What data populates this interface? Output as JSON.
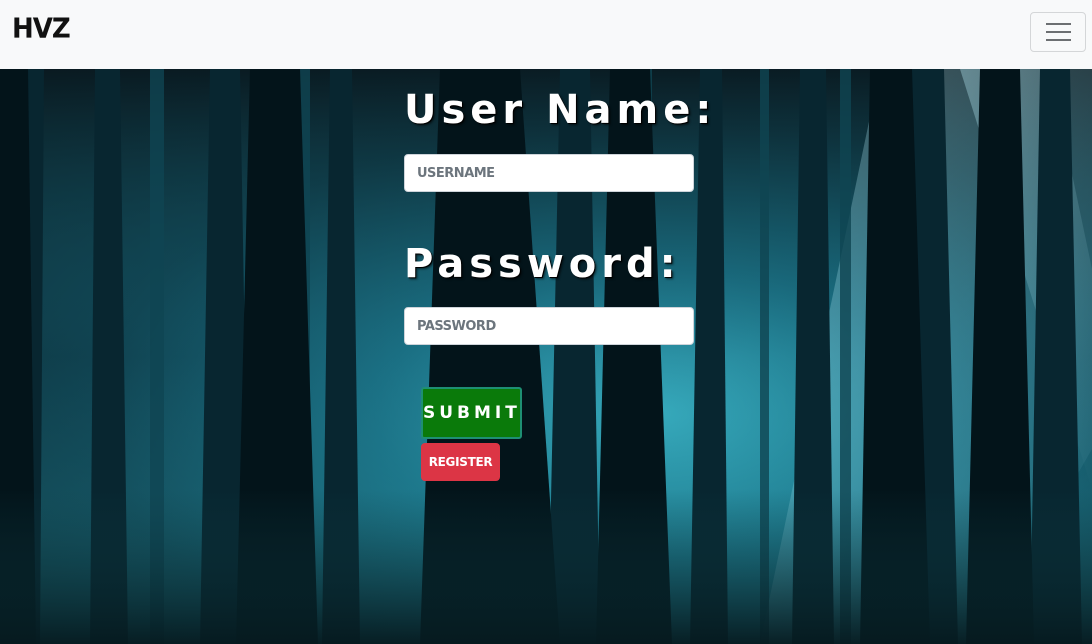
{
  "navbar": {
    "brand": "HVZ",
    "toggler_icon": "hamburger-menu-icon"
  },
  "login_form": {
    "username_label": "User Name:",
    "username_placeholder": "USERNAME",
    "password_label": "Password:",
    "password_placeholder": "PASSWORD",
    "submit_label": "SUBMIT",
    "register_label": "REGISTER"
  },
  "colors": {
    "navbar_bg": "#f8f9fa",
    "submit_bg": "#0a7a0a",
    "register_bg": "#dc3545",
    "label_text": "#ffffff"
  }
}
